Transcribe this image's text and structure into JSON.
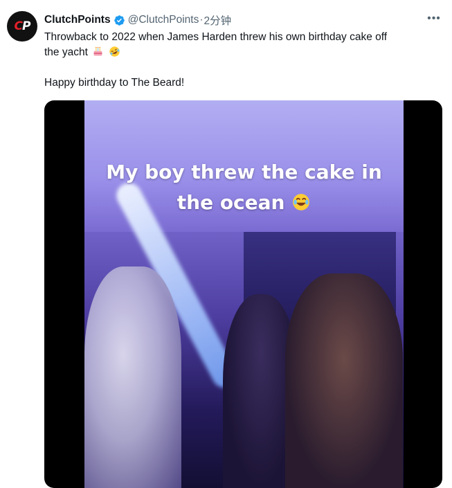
{
  "author": {
    "name": "ClutchPoints",
    "handle": "@ClutchPoints",
    "separator": "·",
    "time": "2分钟",
    "avatar_text": "CP",
    "verified": true
  },
  "tweet": {
    "line1": "Throwback to 2022 when James Harden threw his own birthday cake off",
    "line2": "the yacht",
    "line2_emojis": [
      "cake-emoji",
      "rofl-emoji"
    ],
    "line3": "Happy birthday to The Beard!"
  },
  "media": {
    "caption_line1": "My boy threw the cake in",
    "caption_line2": "the ocean",
    "caption_emoji": "laughing-tears-emoji"
  },
  "colors": {
    "text": "#0f1419",
    "muted": "#536471",
    "verified_blue": "#1d9bf0",
    "logo_red": "#e4202a"
  }
}
